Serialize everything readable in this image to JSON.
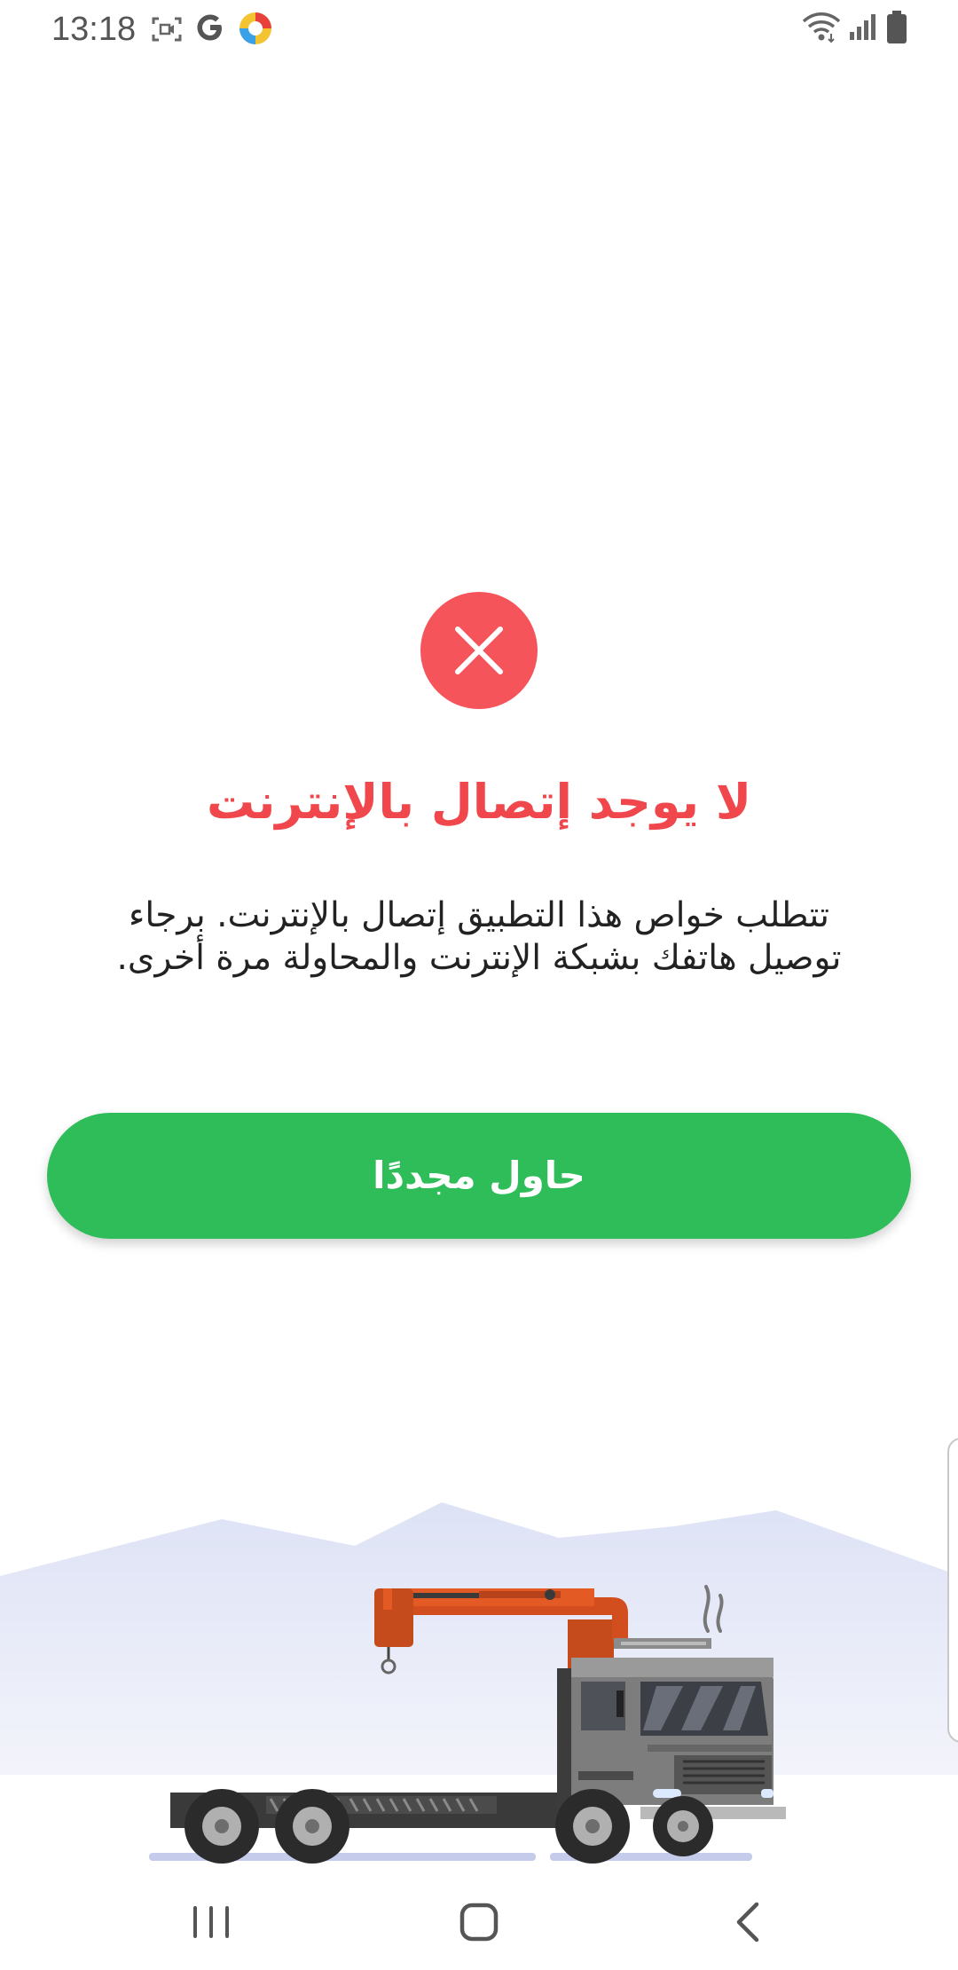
{
  "status_bar": {
    "time": "13:18",
    "icons": [
      "screen-record-icon",
      "google-icon",
      "app-notification-icon",
      "wifi-icon",
      "signal-icon",
      "battery-icon"
    ]
  },
  "error": {
    "icon": "close-icon",
    "title": "لا يوجد إتصال بالإنترنت",
    "message": "تتطلب خواص هذا التطبيق إتصال بالإنترنت. برجاء توصيل هاتفك بشبكة الإنترنت والمحاولة مرة أخرى."
  },
  "retry_button": {
    "label": "حاول مجددًا"
  },
  "nav_bar": {
    "icons": [
      "recent-apps-icon",
      "home-icon",
      "back-icon"
    ]
  },
  "colors": {
    "accent_green": "#2fbd59",
    "error_red": "#f5545a",
    "title_red": "#f0474d"
  }
}
